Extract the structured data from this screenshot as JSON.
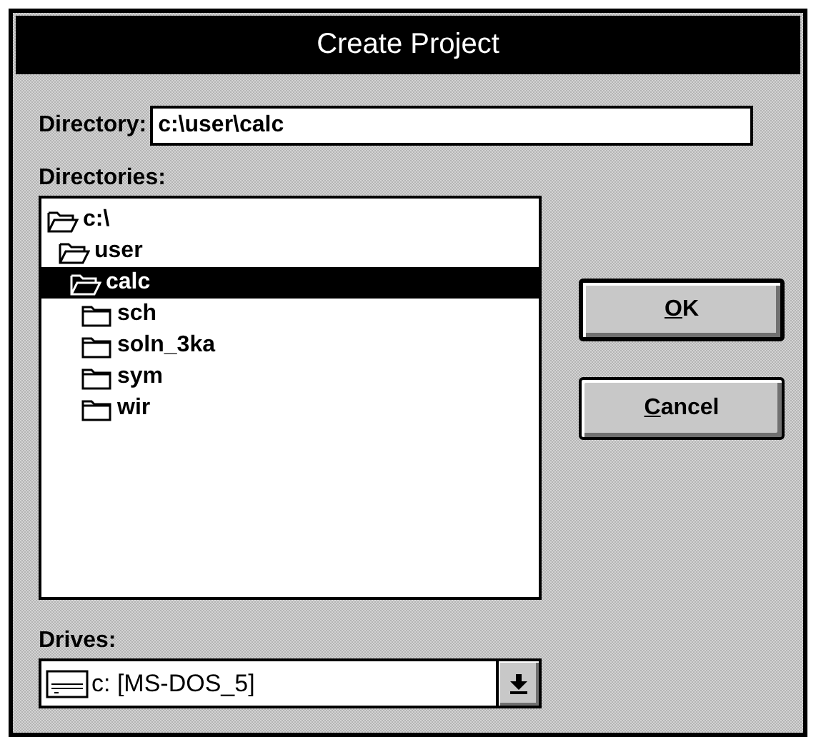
{
  "window": {
    "title": "Create Project"
  },
  "directory_field": {
    "label": "Directory:",
    "value": "c:\\user\\calc"
  },
  "directories": {
    "label": "Directories:",
    "items": [
      {
        "name": "c:\\",
        "open": true,
        "selected": false,
        "children": [
          {
            "name": "user",
            "open": true,
            "selected": false,
            "children": [
              {
                "name": "calc",
                "open": true,
                "selected": true,
                "children": [
                  {
                    "name": "sch",
                    "open": false,
                    "selected": false
                  },
                  {
                    "name": "soln_3ka",
                    "open": false,
                    "selected": false
                  },
                  {
                    "name": "sym",
                    "open": false,
                    "selected": false
                  },
                  {
                    "name": "wir",
                    "open": false,
                    "selected": false
                  }
                ]
              }
            ]
          }
        ]
      }
    ]
  },
  "buttons": [
    {
      "label": "OK",
      "default": true
    },
    {
      "label": "Cancel",
      "default": false
    }
  ],
  "drives": {
    "label": "Drives:",
    "value": "c: [MS-DOS_5]"
  }
}
